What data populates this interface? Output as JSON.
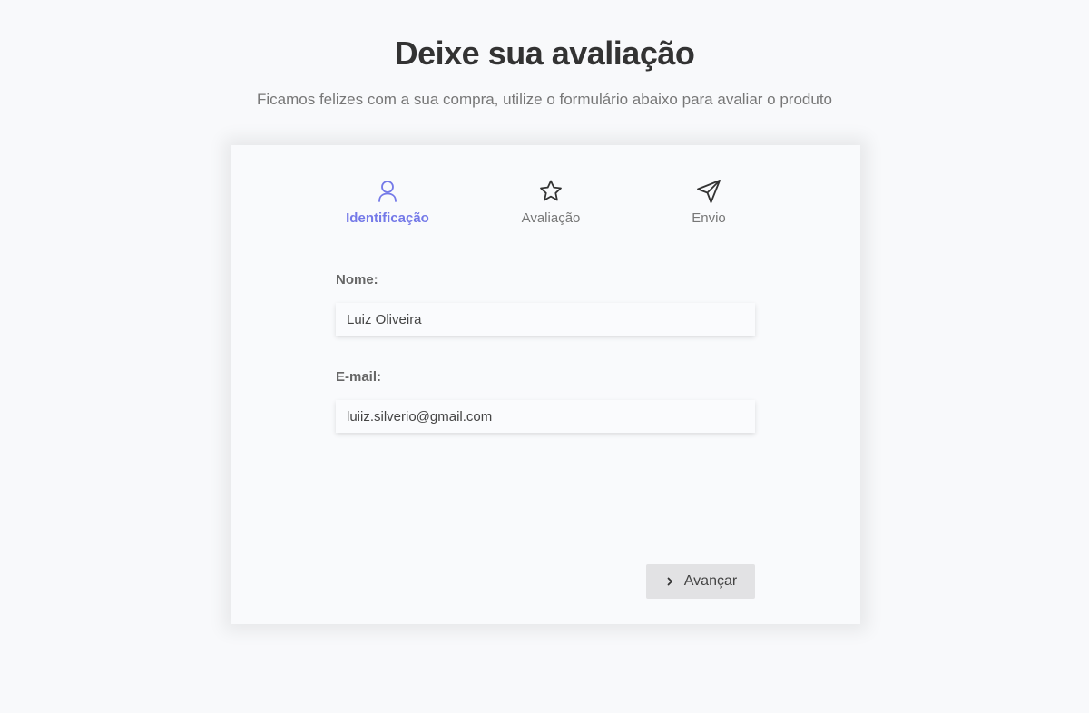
{
  "header": {
    "title": "Deixe sua avaliação",
    "subtitle": "Ficamos felizes com a sua compra, utilize o formulário abaixo para avaliar o produto"
  },
  "stepper": {
    "steps": [
      {
        "label": "Identificação",
        "icon": "user-icon",
        "active": true
      },
      {
        "label": "Avaliação",
        "icon": "star-icon",
        "active": false
      },
      {
        "label": "Envio",
        "icon": "send-icon",
        "active": false
      }
    ]
  },
  "form": {
    "name_label": "Nome:",
    "name_value": "Luiz Oliveira",
    "email_label": "E-mail:",
    "email_value": "luiiz.silverio@gmail.com"
  },
  "actions": {
    "advance_label": "Avançar",
    "advance_icon": "chevron-right-icon"
  },
  "colors": {
    "accent": "#7479e8",
    "background": "#f8f9fb",
    "button_bg": "#e2e2e4"
  }
}
